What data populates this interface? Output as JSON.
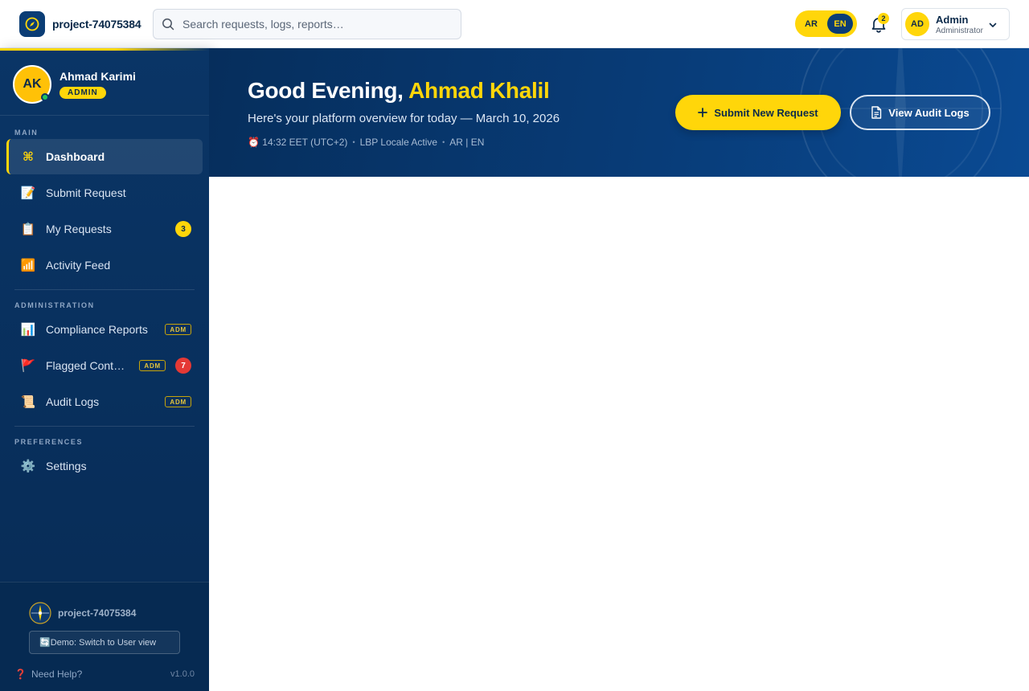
{
  "topbar": {
    "project_name": "project-74075384",
    "search_placeholder": "Search requests, logs, reports…",
    "lang": {
      "ar": "AR",
      "en": "EN",
      "active": "EN"
    },
    "notifications_count": "2",
    "user": {
      "initials": "AD",
      "name": "Admin",
      "role": "Administrator"
    }
  },
  "sidebar": {
    "profile": {
      "initials": "AK",
      "name": "Ahmad Karimi",
      "role_badge": "ADMIN"
    },
    "sections": {
      "main": "MAIN",
      "administration": "ADMINISTRATION",
      "preferences": "PREFERENCES"
    },
    "items": [
      {
        "label": "Dashboard",
        "icon": "⌘"
      },
      {
        "label": "Submit Request",
        "icon": "📝"
      },
      {
        "label": "My Requests",
        "icon": "📋",
        "badge": "3"
      },
      {
        "label": "Activity Feed",
        "icon": "📶"
      },
      {
        "label": "Compliance Reports",
        "icon": "📊",
        "tag": "ADM"
      },
      {
        "label": "Flagged Content",
        "icon": "🚩",
        "tag": "ADM",
        "badge": "7"
      },
      {
        "label": "Audit Logs",
        "icon": "📜",
        "tag": "ADM"
      },
      {
        "label": "Settings",
        "icon": "⚙️"
      }
    ],
    "footer": {
      "project_name": "project-74075384",
      "switch_label": "🔄Demo: Switch to User view",
      "help": "Need Help?",
      "help_icon": "❓",
      "version": "v1.0.0"
    }
  },
  "hero": {
    "greeting": "Good Evening,",
    "name": "Ahmad Khalil",
    "subtitle": "Here's your platform overview for today — March 10, 2026",
    "meta": {
      "time": "⏰ 14:32 EET (UTC+2)",
      "locale": "LBP Locale Active",
      "langs": "AR | EN"
    },
    "primary_button": "Submit New Request",
    "secondary_button": "View Audit Logs"
  },
  "colors": {
    "navy": "#0a3566",
    "accent_yellow": "#ffd60a",
    "badge_red": "#e53935",
    "online_green": "#22c55e"
  }
}
